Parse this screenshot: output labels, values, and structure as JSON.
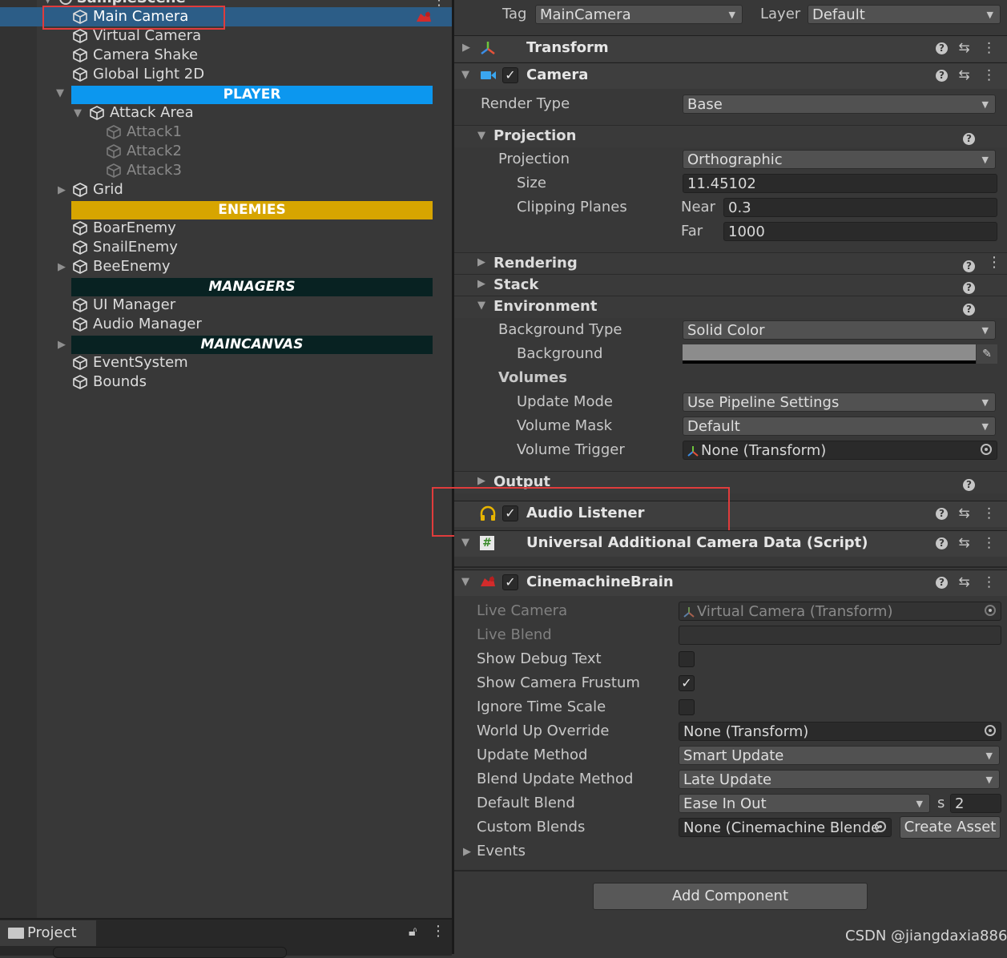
{
  "hierarchy": {
    "scene_name": "SampleScene",
    "items": [
      {
        "label": "Main Camera"
      },
      {
        "label": "Virtual Camera"
      },
      {
        "label": "Camera Shake"
      },
      {
        "label": "Global Light 2D"
      },
      {
        "label": "Attack Area"
      },
      {
        "label": "Attack1"
      },
      {
        "label": "Attack2"
      },
      {
        "label": "Attack3"
      },
      {
        "label": "Grid"
      },
      {
        "label": "BoarEnemy"
      },
      {
        "label": "SnailEnemy"
      },
      {
        "label": "BeeEnemy"
      },
      {
        "label": "UI Manager"
      },
      {
        "label": "Audio Manager"
      },
      {
        "label": "EventSystem"
      },
      {
        "label": "Bounds"
      }
    ],
    "headers": [
      {
        "label": "PLAYER",
        "color": "#0c97ef"
      },
      {
        "label": "ENEMIES",
        "color": "#d7a500"
      },
      {
        "label": "MANAGERS",
        "color": "#082222"
      },
      {
        "label": "MAINCANVAS",
        "color": "#082222"
      }
    ],
    "selection_color": "#2c5d87"
  },
  "project": {
    "tab_label": "Project"
  },
  "inspector": {
    "tag_label": "Tag",
    "tag_value": "MainCamera",
    "layer_label": "Layer",
    "layer_value": "Default",
    "transform": {
      "title": "Transform"
    },
    "camera": {
      "title": "Camera",
      "render_type_label": "Render Type",
      "render_type_value": "Base",
      "projection_section": "Projection",
      "projection_label": "Projection",
      "projection_value": "Orthographic",
      "size_label": "Size",
      "size_value": "11.45102",
      "clipping_label": "Clipping Planes",
      "near_label": "Near",
      "near_value": "0.3",
      "far_label": "Far",
      "far_value": "1000",
      "rendering_section": "Rendering",
      "stack_section": "Stack",
      "environment_section": "Environment",
      "bg_type_label": "Background Type",
      "bg_type_value": "Solid Color",
      "background_label": "Background",
      "background_color": "#8c8c8c",
      "volumes_label": "Volumes",
      "update_mode_label": "Update Mode",
      "update_mode_value": "Use Pipeline Settings",
      "volume_mask_label": "Volume Mask",
      "volume_mask_value": "Default",
      "volume_trigger_label": "Volume Trigger",
      "volume_trigger_value": "None (Transform)",
      "output_section": "Output"
    },
    "audio_listener": {
      "title": "Audio Listener"
    },
    "uacd": {
      "title": "Universal Additional Camera Data (Script)"
    },
    "cinemachine": {
      "title": "CinemachineBrain",
      "live_camera_label": "Live Camera",
      "live_camera_value": "Virtual Camera (Transform)",
      "live_blend_label": "Live Blend",
      "show_debug_label": "Show Debug Text",
      "show_frustum_label": "Show Camera Frustum",
      "ignore_time_label": "Ignore Time Scale",
      "world_up_label": "World Up Override",
      "world_up_value": "None (Transform)",
      "update_method_label": "Update Method",
      "update_method_value": "Smart Update",
      "blend_update_label": "Blend Update Method",
      "blend_update_value": "Late Update",
      "default_blend_label": "Default Blend",
      "default_blend_value": "Ease In Out",
      "blend_s_label": "s",
      "blend_s_value": "2",
      "custom_blends_label": "Custom Blends",
      "custom_blends_value": "None (Cinemachine Blende",
      "create_asset_label": "Create Asset",
      "events_label": "Events"
    },
    "add_component_label": "Add Component",
    "checkmark": "✓"
  },
  "watermark": "CSDN @jiangdaxia886"
}
